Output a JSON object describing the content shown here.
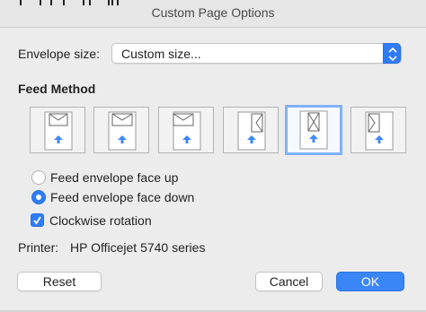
{
  "window": {
    "title": "Custom Page Options"
  },
  "envelope": {
    "label": "Envelope size:",
    "selected": "Custom size..."
  },
  "feed": {
    "heading": "Feed Method",
    "options": [
      {
        "orientation": "landscape",
        "selected": false
      },
      {
        "orientation": "landscape",
        "selected": false
      },
      {
        "orientation": "landscape",
        "selected": false
      },
      {
        "orientation": "portrait",
        "selected": false
      },
      {
        "orientation": "portrait",
        "selected": true
      },
      {
        "orientation": "portrait",
        "selected": false
      }
    ],
    "face_up_label": "Feed envelope face up",
    "face_down_label": "Feed envelope face down",
    "face_down_selected": true,
    "clockwise_label": "Clockwise rotation",
    "clockwise_checked": true
  },
  "printer": {
    "label": "Printer:",
    "name": "HP Officejet 5740 series"
  },
  "buttons": {
    "reset": "Reset",
    "cancel": "Cancel",
    "ok": "OK"
  },
  "colors": {
    "accent": "#2f7cf6",
    "selection_border": "#7fb1f8"
  }
}
